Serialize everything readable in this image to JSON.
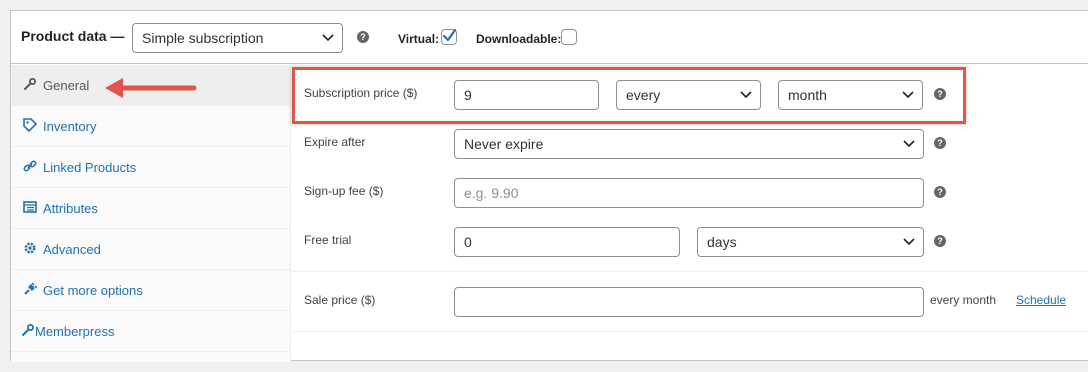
{
  "header": {
    "title": "Product data —",
    "product_type": "Simple subscription",
    "virtual_label": "Virtual:",
    "virtual_checked": true,
    "downloadable_label": "Downloadable:",
    "downloadable_checked": false
  },
  "sidebar": {
    "items": [
      {
        "label": "General",
        "icon": "wrench-icon",
        "active": true
      },
      {
        "label": "Inventory",
        "icon": "tag-icon",
        "active": false
      },
      {
        "label": "Linked Products",
        "icon": "link-icon",
        "active": false
      },
      {
        "label": "Attributes",
        "icon": "list-icon",
        "active": false
      },
      {
        "label": "Advanced",
        "icon": "gear-icon",
        "active": false
      },
      {
        "label": "Get more options",
        "icon": "plug-icon",
        "active": false
      },
      {
        "label": "Memberpress",
        "icon": "wrench-icon",
        "active": false
      }
    ]
  },
  "fields": {
    "subscription_price": {
      "label": "Subscription price ($)",
      "value": "9",
      "interval": "every",
      "period": "month"
    },
    "expire_after": {
      "label": "Expire after",
      "value": "Never expire"
    },
    "signup_fee": {
      "label": "Sign-up fee ($)",
      "placeholder": "e.g. 9.90"
    },
    "free_trial": {
      "label": "Free trial",
      "value": "0",
      "period": "days"
    },
    "sale_price": {
      "label": "Sale price ($)",
      "value": "",
      "suffix": "every month",
      "schedule_link": "Schedule"
    }
  },
  "help_glyph": "?",
  "colors": {
    "accent": "#2271b1",
    "highlight": "#e0544a"
  }
}
